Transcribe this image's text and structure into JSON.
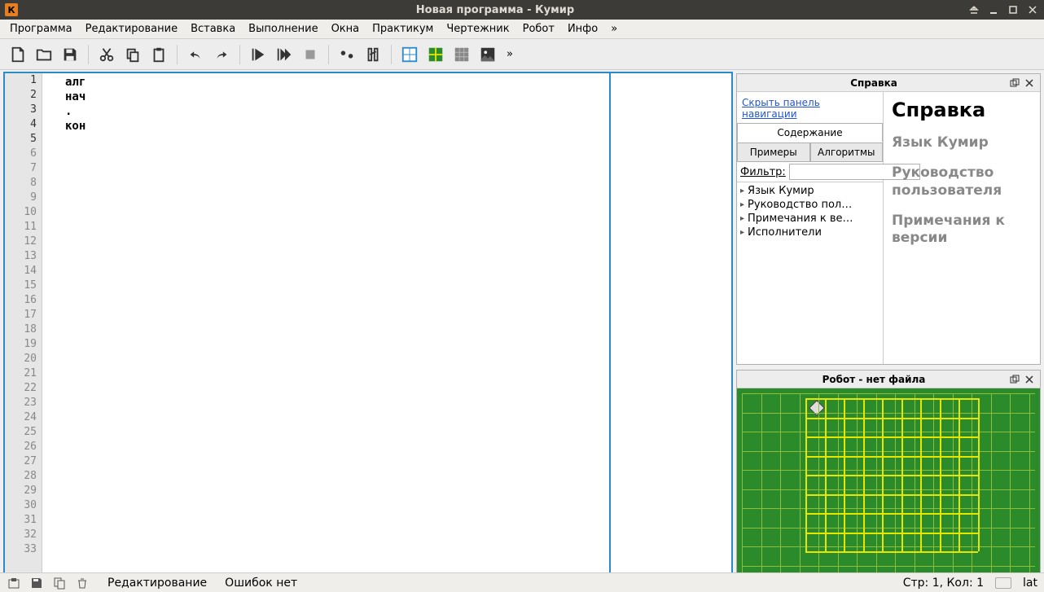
{
  "window": {
    "title": "Новая программа - Кумир",
    "app_icon_letter": "К"
  },
  "menus": [
    "Программа",
    "Редактирование",
    "Вставка",
    "Выполнение",
    "Окна",
    "Практикум",
    "Чертежник",
    "Робот",
    "Инфо",
    "»"
  ],
  "toolbar_icons": [
    "new-file-icon",
    "open-file-icon",
    "save-file-icon",
    "sep",
    "cut-icon",
    "copy-icon",
    "paste-icon",
    "sep",
    "undo-icon",
    "redo-icon",
    "sep",
    "run-icon",
    "run-step-icon",
    "stop-icon",
    "sep",
    "toggle1-icon",
    "toggle2-icon",
    "sep",
    "grid-blue-icon",
    "grid-green-icon",
    "grid-gray-icon",
    "grid-image-icon",
    "overflow-icon"
  ],
  "editor": {
    "lines": [
      "алг",
      "нач",
      ".",
      "кон",
      ""
    ],
    "total_gutter_lines": 33
  },
  "help_panel": {
    "title": "Справка",
    "hide_nav_link": "Скрыть панель навигации",
    "tabs": {
      "contents": "Содержание",
      "examples": "Примеры",
      "algorithms": "Алгоритмы"
    },
    "filter_label": "Фильтр:",
    "tree": [
      "Язык Кумир",
      "Руководство пол…",
      "Примечания к ве…",
      "Исполнители"
    ],
    "content": {
      "heading": "Справка",
      "sections": [
        "Язык Кумир",
        "Руководство пользователя",
        "Примечания к версии"
      ]
    }
  },
  "robot_panel": {
    "title": "Робот - нет файла"
  },
  "statusbar": {
    "mode": "Редактирование",
    "errors": "Ошибок нет",
    "position": "Стр: 1, Кол: 1",
    "layout": "lat"
  }
}
